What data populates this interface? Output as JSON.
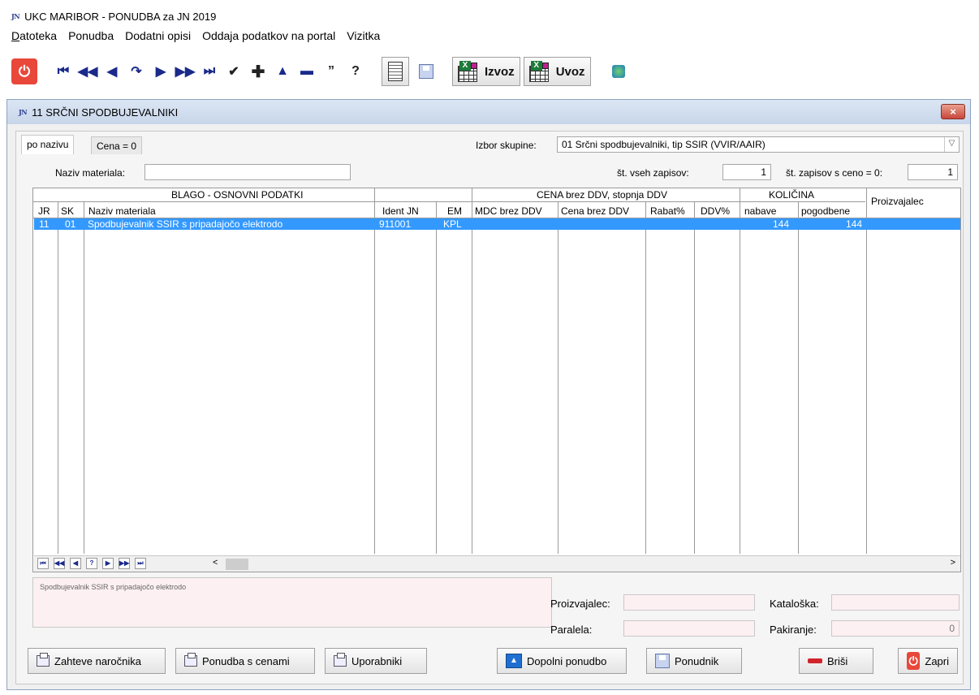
{
  "app": {
    "logo": "JN",
    "title": "UKC MARIBOR - PONUDBA za JN 2019"
  },
  "menu": [
    "Datoteka",
    "Ponudba",
    "Dodatni opisi",
    "Oddaja podatkov na portal",
    "Vizitka"
  ],
  "toolbar": {
    "export_label": "Izvoz",
    "import_label": "Uvoz"
  },
  "child": {
    "logo": "JN",
    "title": "11 SRČNI SPODBUJEVALNIKI",
    "close": "×"
  },
  "tabs": [
    "po nazivu",
    "Cena = 0"
  ],
  "filters": {
    "group_label": "Izbor skupine:",
    "group_value": "01 Srčni spodbujevalniki, tip SSIR (VVIR/AAIR)",
    "name_label": "Naziv materiala:",
    "name_value": "",
    "total_label": "št. vseh zapisov:",
    "total_value": "1",
    "zero_label": "št. zapisov s ceno = 0:",
    "zero_value": "1"
  },
  "grid": {
    "group_headers": [
      "BLAGO - OSNOVNI PODATKI",
      "CENA brez DDV, stopnja DDV",
      "KOLIČINA"
    ],
    "columns": [
      "JR",
      "SK",
      "Naziv materiala",
      "Ident JN",
      "EM",
      "MDC brez DDV",
      "Cena brez DDV",
      "Rabat%",
      "DDV%",
      "nabave",
      "pogodbene",
      "Proizvajalec"
    ],
    "rows": [
      {
        "jr": "11",
        "sk": "01",
        "naziv": "Spodbujevalnik SSIR s pripadajočo elektrodo",
        "ident": "911001",
        "em": "KPL",
        "mdc": "",
        "cena": "",
        "rabat": "",
        "ddv": "",
        "nabave": "144",
        "pogodbene": "144",
        "proizvajalec": ""
      }
    ]
  },
  "details": {
    "description": "Spodbujevalnik SSIR s pripadajočo elektrodo",
    "manufacturer_label": "Proizvajalec:",
    "manufacturer_value": "",
    "catalog_label": "Kataloška:",
    "catalog_value": "",
    "parallel_label": "Paralela:",
    "parallel_value": "",
    "packaging_label": "Pakiranje:",
    "packaging_value": "0"
  },
  "buttons": {
    "requirements": "Zahteve naročnika",
    "offer_prices": "Ponudba s cenami",
    "users": "Uporabniki",
    "complete_offer": "Dopolni ponudbo",
    "bidder": "Ponudnik",
    "delete": "Briši",
    "close": "Zapri"
  }
}
